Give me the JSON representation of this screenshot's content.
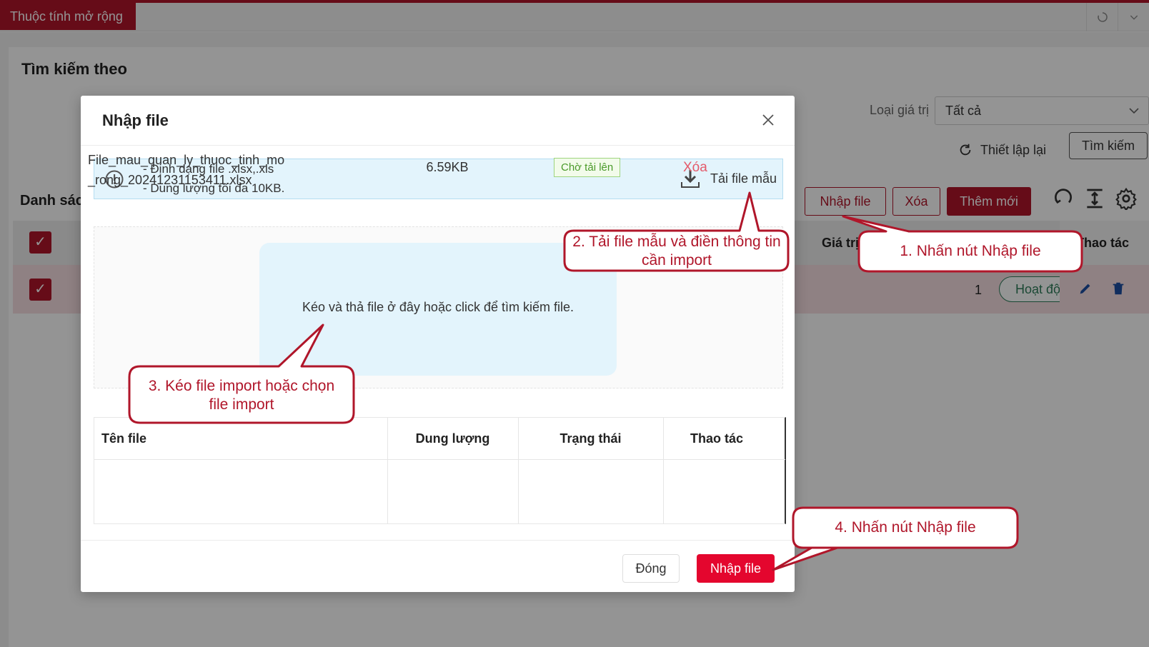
{
  "app": {
    "tab_title": "Thuộc tính mở rộng",
    "search_title": "Tìm kiếm theo",
    "filter_label": "Loại giá trị",
    "filter_value": "Tất cả",
    "reset_label": "Thiết lập lại",
    "search_button": "Tìm kiếm",
    "list_title": "Danh sách",
    "toolbar": {
      "import_label": "Nhập file",
      "delete_label": "Xóa",
      "add_label": "Thêm mới"
    },
    "table": {
      "col_value": "Giá trị",
      "col_actions": "Thao tác",
      "row": {
        "value": "1",
        "status": "Hoạt động"
      }
    }
  },
  "modal": {
    "title": "Nhập file",
    "info_lines": [
      "- Định dạng file .xlsx,.xls",
      "- Dung lượng tối đa 10KB."
    ],
    "template_link": "Tải file mẫu",
    "dropzone_text": "Kéo và thả file ở đây hoặc click để tìm kiếm file.",
    "file_table": {
      "headers": [
        "Tên file",
        "Dung lượng",
        "Trạng thái",
        "Thao tác"
      ],
      "rows": [
        {
          "name": "File_mau_quan_ly_thuoc_tinh_mo_rong_20241231153411.xlsx",
          "size": "6.59KB",
          "status": "Chờ tải lên",
          "action": "Xóa"
        }
      ]
    },
    "close_button": "Đóng",
    "import_button": "Nhập file"
  },
  "callouts": {
    "step1": "1. Nhấn nút Nhập file",
    "step2": "2. Tải file mẫu và điền thông tin cần import",
    "step3": "3. Kéo file import hoặc chọn file import",
    "step4": "4. Nhấn nút Nhập file"
  },
  "colors": {
    "brand": "#b0162a",
    "primary_button": "#e4062e",
    "info_bg": "#e3f4fc",
    "status_green": "#4a9a2a"
  },
  "icons": [
    "refresh-icon",
    "chevron-down-icon",
    "close-icon",
    "info-icon",
    "download-icon",
    "settings-icon",
    "column-height-icon",
    "pencil-icon",
    "trash-icon",
    "checkbox-icon"
  ]
}
